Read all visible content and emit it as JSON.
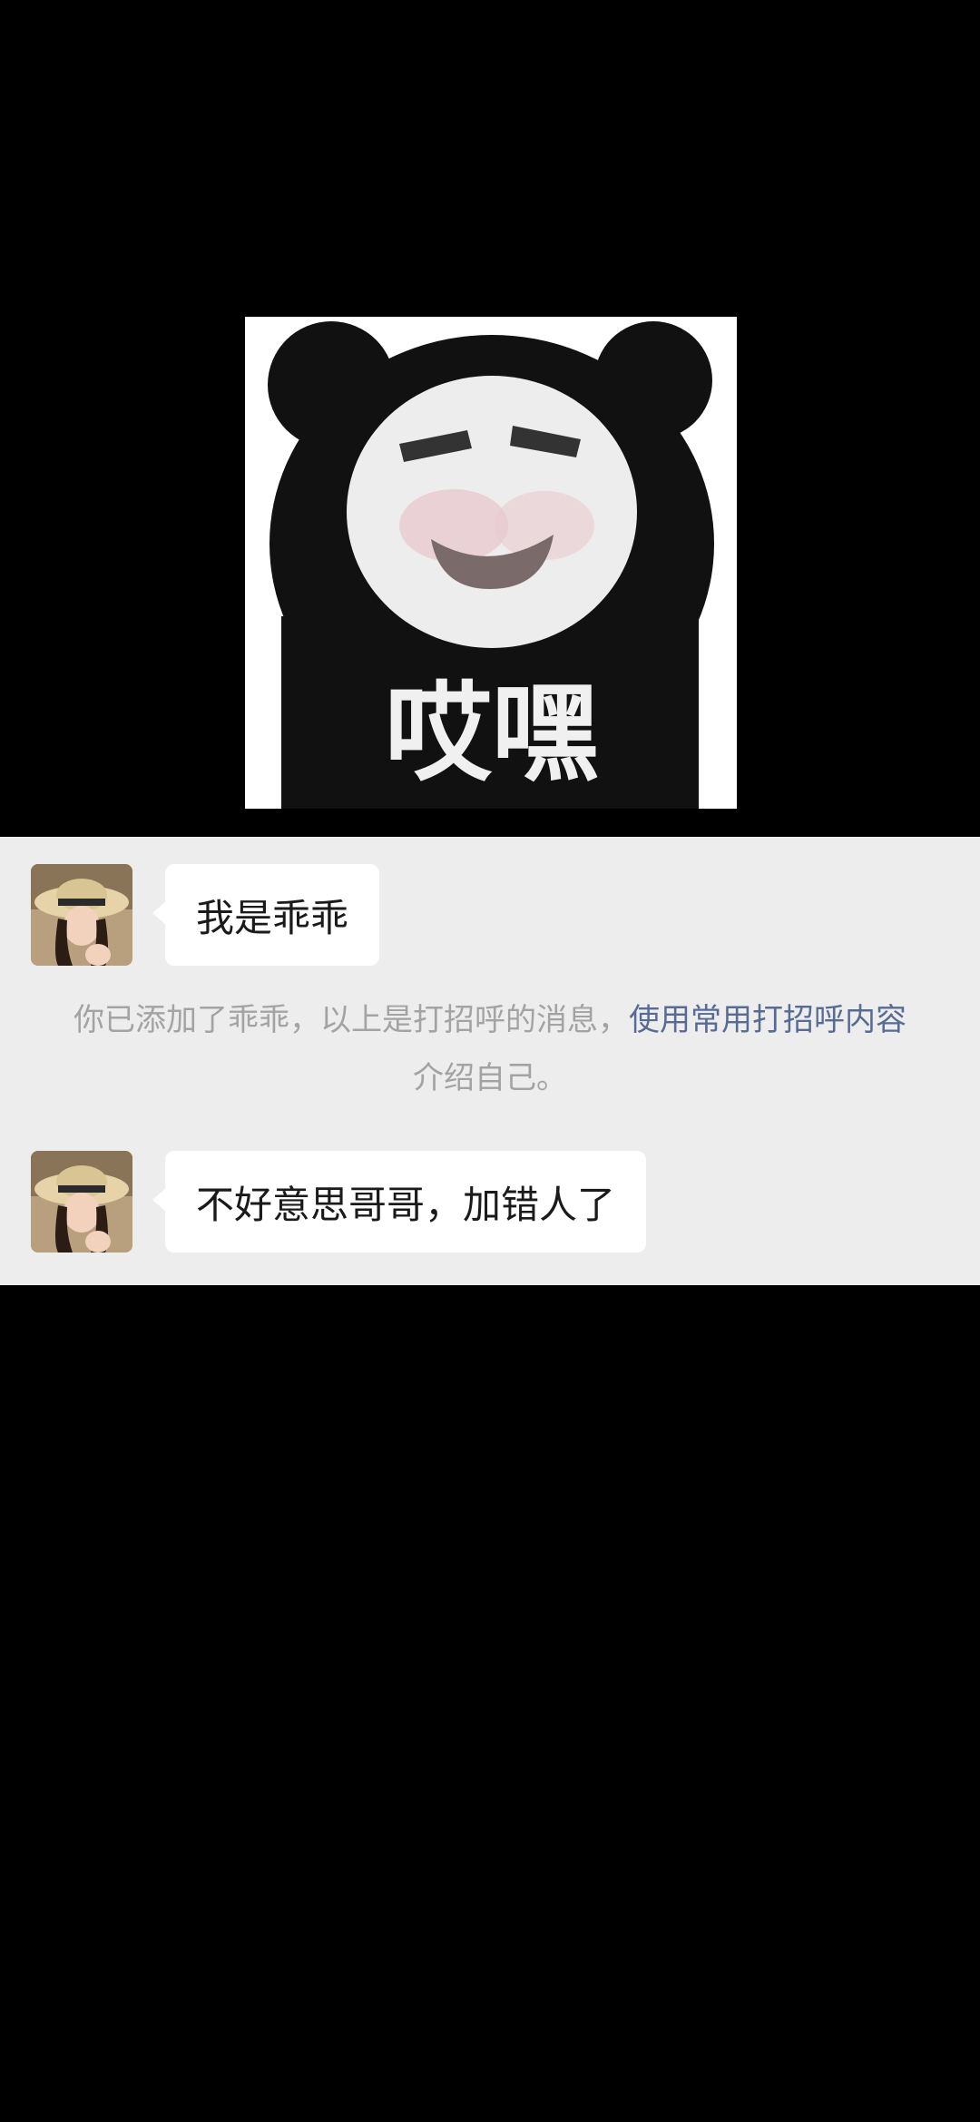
{
  "sticker": {
    "caption": "哎嘿",
    "icon": "panda-meme-sticker"
  },
  "messages": [
    {
      "type": "received",
      "avatar": "avatar-girl-straw-hat",
      "text": "我是乖乖"
    },
    {
      "type": "received",
      "avatar": "avatar-girl-straw-hat",
      "text": "不好意思哥哥，加错人了"
    }
  ],
  "system_notice": {
    "prefix": "你已添加了乖乖，以上是打招呼的消息，",
    "link": "使用常用打招呼内容",
    "suffix": "介绍自己。"
  },
  "colors": {
    "chat_background": "#ededed",
    "bubble": "#ffffff",
    "link": "#576b95",
    "system_text": "#a3a3a3"
  }
}
